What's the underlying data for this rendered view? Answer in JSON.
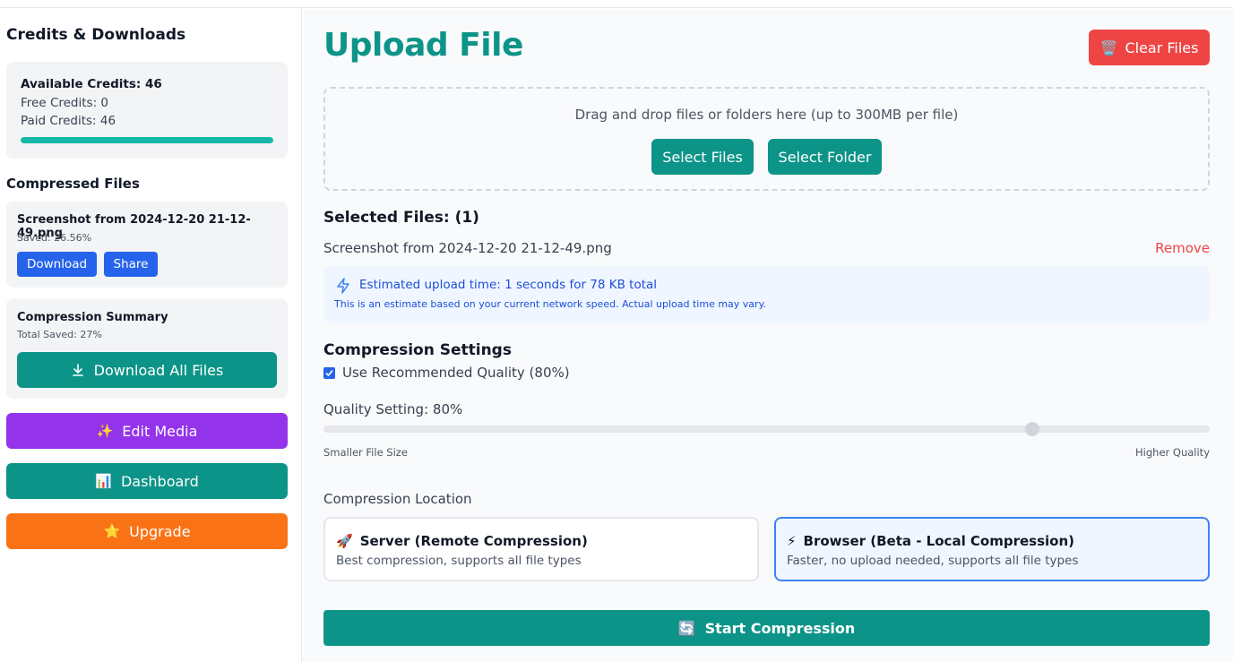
{
  "sidebar": {
    "title": "Credits & Downloads",
    "credits": {
      "available": "Available Credits: 46",
      "free": "Free Credits: 0",
      "paid": "Paid Credits: 46",
      "bar_fill_fraction": 1.0,
      "bar_color": "#14b8a6"
    },
    "compressed_title": "Compressed Files",
    "files": [
      {
        "name": "Screenshot from 2024-12-20 21-12-49.png",
        "saved": "Saved: 26.56%",
        "download_label": "Download",
        "share_label": "Share"
      }
    ],
    "summary": {
      "title": "Compression Summary",
      "total_saved": "Total Saved: 27%",
      "download_all_label": "Download All Files",
      "download_all_icon": "download-icon"
    },
    "actions": [
      {
        "label": "Edit Media",
        "icon": "✨",
        "color": "#9333ea"
      },
      {
        "label": "Dashboard",
        "icon": "📊",
        "color": "#0d9488"
      },
      {
        "label": "Upgrade",
        "icon": "⭐",
        "color": "#f97316"
      }
    ]
  },
  "main": {
    "title": "Upload File",
    "clear_label": "Clear Files",
    "clear_icon": "🗑️",
    "dropzone": {
      "text": "Drag and drop files or folders here (up to 300MB per file)",
      "select_files_label": "Select Files",
      "select_folder_label": "Select Folder"
    },
    "selected": {
      "title": "Selected Files: (1)",
      "file_name": "Screenshot from 2024-12-20 21-12-49.png",
      "remove_label": "Remove"
    },
    "estimate": {
      "icon": "lightning-icon",
      "main": "Estimated upload time: 1 seconds for 78 KB total",
      "sub": "This is an estimate based on your current network speed. Actual upload time may vary."
    },
    "compression_settings": {
      "title": "Compression Settings",
      "recommended_label": "Use Recommended Quality (80%)",
      "recommended_checked": true,
      "quality_label": "Quality Setting: 80%",
      "quality_value": 80,
      "min_label": "Smaller File Size",
      "max_label": "Higher Quality"
    },
    "location": {
      "title": "Compression Location",
      "options": [
        {
          "icon": "🚀",
          "title": "Server (Remote Compression)",
          "desc": "Best compression, supports all file types",
          "selected": false
        },
        {
          "icon": "⚡",
          "title": "Browser (Beta - Local Compression)",
          "desc": "Faster, no upload needed, supports all file types",
          "selected": true
        }
      ]
    },
    "start_label": "Start Compression",
    "start_icon": "🔄"
  },
  "colors": {
    "teal": "#0d9488",
    "blue": "#2563eb",
    "red": "#ef4444",
    "purple": "#9333ea",
    "orange": "#f97316"
  }
}
